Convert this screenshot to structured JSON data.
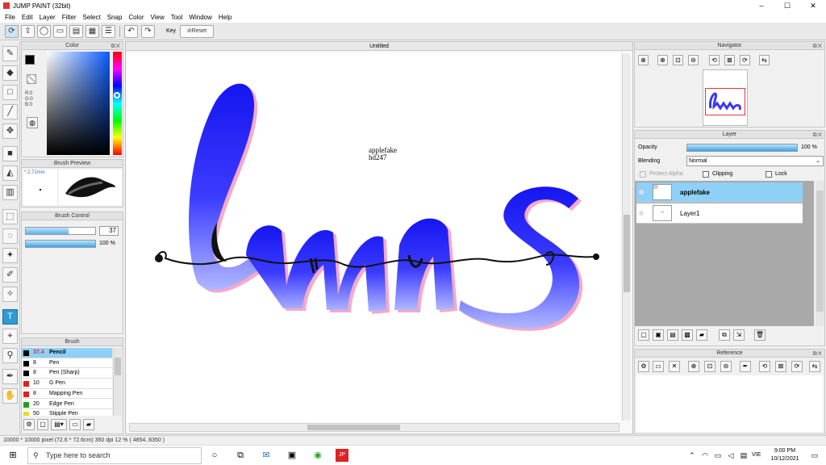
{
  "window": {
    "title": "JUMP PAINT (32bit)",
    "minimize": "–",
    "maximize": "☐",
    "close": "✕"
  },
  "menu": [
    "File",
    "Edit",
    "Layer",
    "Filter",
    "Select",
    "Snap",
    "Color",
    "View",
    "Tool",
    "Window",
    "Help"
  ],
  "toolbar": {
    "key_label": "Key",
    "reset_label": "Reset"
  },
  "panels": {
    "color": "Color",
    "brush_preview": "Brush Preview",
    "brush_control": "Brush Control",
    "brush": "Brush",
    "navigator": "Navigator",
    "layer": "Layer",
    "reference": "Reference"
  },
  "color": {
    "r": "R:0",
    "g": "G:0",
    "b": "B:0",
    "foreground": "#000000",
    "background": "#1a1aff"
  },
  "brush_preview": {
    "size": "* 2.71mm"
  },
  "brush_control": {
    "size_value": "37",
    "size_fraction": 0.62,
    "opacity_value": "100 %",
    "opacity_fraction": 1.0
  },
  "brushes": [
    {
      "size": "37.4",
      "name": "Pencil",
      "color": "#000000",
      "selected": true
    },
    {
      "size": "8",
      "name": "Pen",
      "color": "#000000",
      "selected": false
    },
    {
      "size": "8",
      "name": "Pen (Sharp)",
      "color": "#000000",
      "selected": false
    },
    {
      "size": "10",
      "name": "G Pen",
      "color": "#e02020",
      "selected": false
    },
    {
      "size": "8",
      "name": "Mapping Pen",
      "color": "#e02020",
      "selected": false
    },
    {
      "size": "20",
      "name": "Edge Pen",
      "color": "#20a020",
      "selected": false
    },
    {
      "size": "50",
      "name": "Stipple Pen",
      "color": "#e0e020",
      "selected": false
    }
  ],
  "document": {
    "tab_title": "Untitled",
    "watermark_line1": "applefake",
    "watermark_line2": "hd247",
    "art_text": "luns"
  },
  "layer": {
    "opacity_label": "Opacity",
    "opacity_value": "100 %",
    "opacity_fraction": 1.0,
    "blending_label": "Blending",
    "blending_value": "Normal",
    "protect_alpha": "Protect Alpha",
    "clipping": "Clipping",
    "lock": "Lock",
    "layers": [
      {
        "name": "applefake",
        "selected": true
      },
      {
        "name": "Layer1",
        "selected": false
      }
    ]
  },
  "status": {
    "text": "10000 * 10000 pixel   (72.6 * 72.6cm)   350 dpi   12 %   ( 4854, 8350 )"
  },
  "taskbar": {
    "search_placeholder": "Type here to search",
    "language": "VIE",
    "time": "9:00 PM",
    "date": "10/12/2021"
  }
}
